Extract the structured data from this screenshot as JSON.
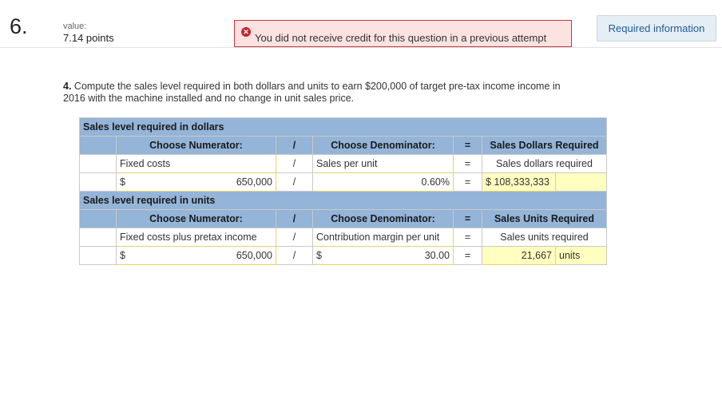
{
  "question": {
    "number": "6.",
    "value_label": "value:",
    "points": "7.14 points",
    "alert": "You did not receive credit for this question in a previous attempt",
    "required_info": "Required information",
    "part_number": "4.",
    "part_text": "Compute the sales level required in both dollars and units to earn $200,000 of target pre-tax income income in 2016 with the machine installed and no change in unit sales price."
  },
  "dollars_section": {
    "title": "Sales level required in dollars",
    "header": {
      "numerator": "Choose Numerator:",
      "slash": "/",
      "denominator": "Choose Denominator:",
      "equals": "=",
      "result": "Sales Dollars Required"
    },
    "label_row": {
      "numerator": "Fixed costs",
      "slash": "/",
      "denominator": "Sales per unit",
      "equals": "=",
      "result": "Sales dollars required"
    },
    "value_row": {
      "currency": "$",
      "numerator": "650,000",
      "slash": "/",
      "denominator": "0.60%",
      "equals": "=",
      "result_currency": "$",
      "result": "108,333,333"
    }
  },
  "units_section": {
    "title": "Sales level required in units",
    "header": {
      "numerator": "Choose Numerator:",
      "slash": "/",
      "denominator": "Choose Denominator:",
      "equals": "=",
      "result": "Sales Units Required"
    },
    "label_row": {
      "numerator": "Fixed costs plus pretax income",
      "slash": "/",
      "denominator": "Contribution margin per unit",
      "equals": "=",
      "result": "Sales units required"
    },
    "value_row": {
      "currency": "$",
      "numerator": "650,000",
      "slash": "/",
      "denominator_currency": "$",
      "denominator": "30.00",
      "equals": "=",
      "result": "21,667",
      "result_unit": "units"
    }
  },
  "colors": {
    "header_blue": "#94b4d8",
    "highlight_yellow": "#ffffc0",
    "alert_red": "#c4262e",
    "link_blue": "#1f5b95"
  }
}
